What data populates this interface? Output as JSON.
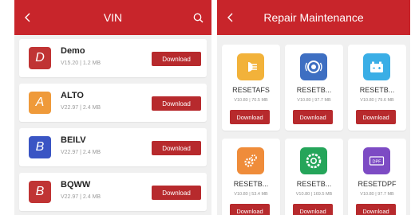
{
  "vin_screen": {
    "title": "VIN",
    "download_label": "Download",
    "items": [
      {
        "letter": "D",
        "name": "Demo",
        "meta": "V15.20 | 1.2 MB",
        "color": "#c03434"
      },
      {
        "letter": "A",
        "name": "ALTO",
        "meta": "V22.97 | 2.4 MB",
        "color": "#ef9a3a"
      },
      {
        "letter": "B",
        "name": "BEILV",
        "meta": "V22.97 | 2.4 MB",
        "color": "#3a55c4"
      },
      {
        "letter": "B",
        "name": "BQWW",
        "meta": "V22.97 | 2.4 MB",
        "color": "#c03434"
      }
    ]
  },
  "repair_screen": {
    "title": "Repair Maintenance",
    "download_label": "Download",
    "items": [
      {
        "name": "RESETAFS",
        "meta": "V10.80 | 70.5 MB",
        "icon": "headlight-icon",
        "color": "#f2b23a"
      },
      {
        "name": "RESETB...",
        "meta": "V10.80 | 97.7 MB",
        "icon": "brake-disc-icon",
        "color": "#3e6fc2"
      },
      {
        "name": "RESETB...",
        "meta": "V10.80 | 79.6 MB",
        "icon": "battery-icon",
        "color": "#3aaee6"
      },
      {
        "name": "RESETB...",
        "meta": "V10.80 | 53.4 MB",
        "icon": "gears-icon",
        "color": "#ef8c3a"
      },
      {
        "name": "RESETB...",
        "meta": "V10.80 | 169.5 MB",
        "icon": "tire-icon",
        "color": "#25a55a"
      },
      {
        "name": "RESETDPF",
        "meta": "V10.80 | 97.7 MB",
        "icon": "dpf-icon",
        "color": "#7d4bc4"
      }
    ]
  }
}
